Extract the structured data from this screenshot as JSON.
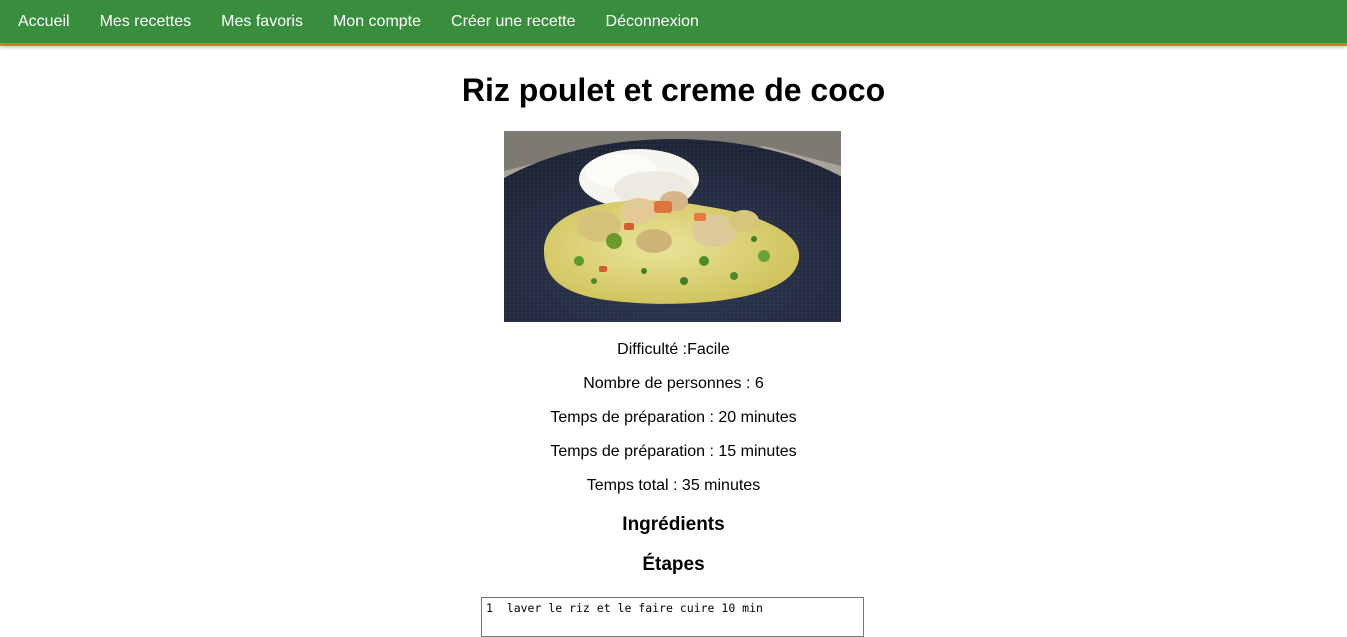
{
  "nav": {
    "items": [
      {
        "label": "Accueil"
      },
      {
        "label": "Mes recettes"
      },
      {
        "label": "Mes favoris"
      },
      {
        "label": "Mon compte"
      },
      {
        "label": "Créer une recette"
      },
      {
        "label": "Déconnexion"
      }
    ]
  },
  "recipe": {
    "title": "Riz poulet et creme de coco",
    "difficulty": "Difficulté :Facile",
    "servings": "Nombre de personnes : 6",
    "prep_time": "Temps de préparation : 20 minutes",
    "cook_time": "Temps de préparation : 15 minutes",
    "total_time": "Temps total : 35 minutes"
  },
  "sections": {
    "ingredients_heading": "Ingrédients",
    "steps_heading": "Étapes"
  },
  "steps": {
    "value": "1  laver le riz et le faire cuire 10 min"
  },
  "colors": {
    "nav_background": "#388e3c",
    "nav_accent": "#d9772b",
    "nav_text": "#ffffff"
  }
}
